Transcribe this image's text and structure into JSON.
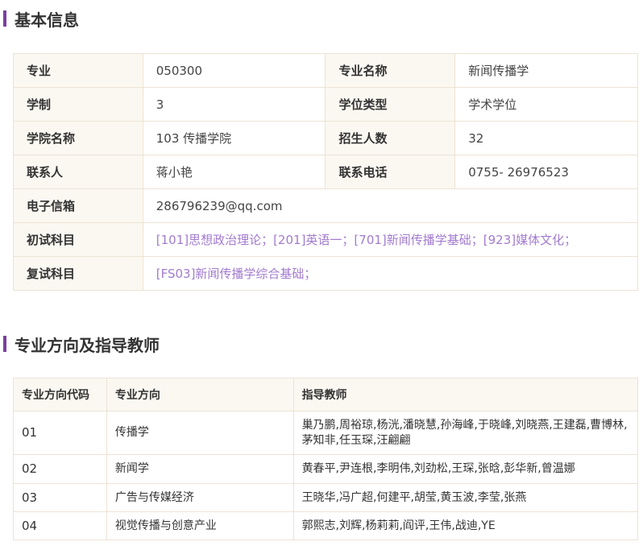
{
  "basic_info": {
    "title": "基本信息",
    "rows": [
      {
        "l1": "专业",
        "v1": "050300",
        "l2": "专业名称",
        "v2": "新闻传播学"
      },
      {
        "l1": "学制",
        "v1": "3",
        "l2": "学位类型",
        "v2": "学术学位"
      },
      {
        "l1": "学院名称",
        "v1": "103 传播学院",
        "l2": "招生人数",
        "v2": "32"
      },
      {
        "l1": "联系人",
        "v1": "蒋小艳",
        "l2": "联系电话",
        "v2": "0755- 26976523"
      }
    ],
    "email_label": "电子信箱",
    "email_value": "286796239@qq.com",
    "first_exam_label": "初试科目",
    "first_exam_value": "[101]思想政治理论；[201]英语一；[701]新闻传播学基础；[923]媒体文化；",
    "retest_label": "复试科目",
    "retest_value": "[FS03]新闻传播学综合基础；"
  },
  "directions": {
    "title": "专业方向及指导教师",
    "headers": {
      "code": "专业方向代码",
      "name": "专业方向",
      "teachers": "指导教师"
    },
    "rows": [
      {
        "code": "01",
        "name": "传播学",
        "teachers": "巢乃鹏,周裕琼,杨洸,潘晓慧,孙海峰,于晓峰,刘晓燕,王建磊,曹博林,茅知非,任玉琛,汪翩翩"
      },
      {
        "code": "02",
        "name": "新闻学",
        "teachers": "黄春平,尹连根,李明伟,刘劲松,王琛,张晗,彭华新,曾温娜"
      },
      {
        "code": "03",
        "name": "广告与传媒经济",
        "teachers": "王晓华,冯广超,何建平,胡莹,黄玉波,李莹,张燕"
      },
      {
        "code": "04",
        "name": "视觉传播与创意产业",
        "teachers": "郭熙志,刘辉,杨莉莉,阎评,王伟,战迪,YE"
      }
    ]
  },
  "colors": {
    "accent": "#7b3fa0",
    "link": "#a27bd0",
    "label_bg": "#fbf8f2",
    "border": "#ece3d4"
  }
}
